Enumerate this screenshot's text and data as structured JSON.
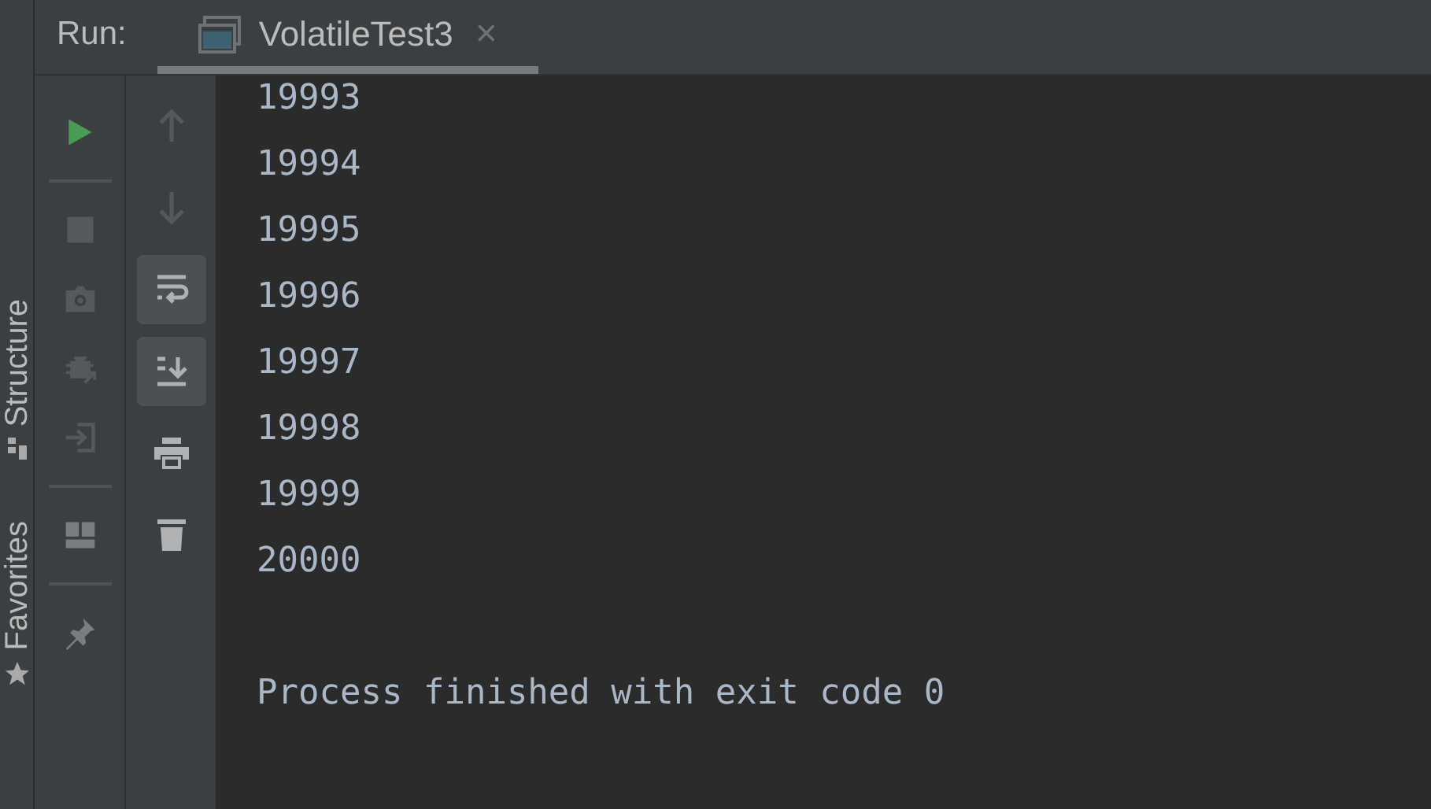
{
  "header": {
    "label": "Run:",
    "tabs": [
      {
        "title": "VolatileTest3",
        "close": "×",
        "selected": true
      }
    ]
  },
  "side_tabs": [
    {
      "label": "Structure"
    },
    {
      "label": "Favorites"
    }
  ],
  "left_toolbar": [
    {
      "kind": "run",
      "disabled": false
    },
    {
      "kind": "separator"
    },
    {
      "kind": "stop",
      "disabled": true
    },
    {
      "kind": "camera",
      "disabled": true
    },
    {
      "kind": "bug",
      "disabled": true
    },
    {
      "kind": "login",
      "disabled": true
    },
    {
      "kind": "separator"
    },
    {
      "kind": "layout",
      "disabled": false
    },
    {
      "kind": "separator"
    },
    {
      "kind": "pin",
      "disabled": false
    }
  ],
  "right_toolbar": [
    {
      "kind": "up",
      "selected": false,
      "disabled": true
    },
    {
      "kind": "down",
      "selected": false,
      "disabled": true
    },
    {
      "kind": "wrap",
      "selected": true,
      "disabled": false
    },
    {
      "kind": "scroll",
      "selected": true,
      "disabled": false
    },
    {
      "kind": "print",
      "selected": false,
      "disabled": false
    },
    {
      "kind": "trash",
      "selected": false,
      "disabled": false
    }
  ],
  "console": {
    "lines": [
      "19993",
      "19994",
      "19995",
      "19996",
      "19997",
      "19998",
      "19999",
      "20000"
    ],
    "exit_message": "Process finished with exit code 0"
  }
}
